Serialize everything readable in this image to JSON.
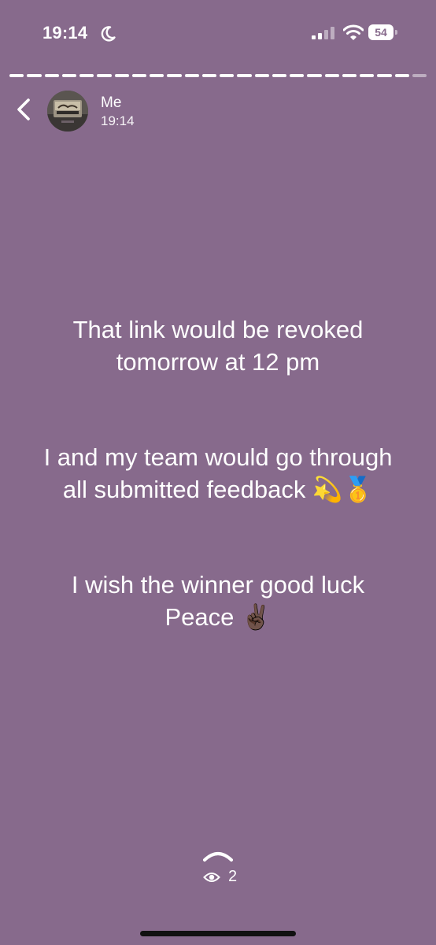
{
  "status_bar": {
    "time": "19:14",
    "battery": "54",
    "icons": [
      "moon-icon",
      "signal-icon",
      "wifi-icon",
      "battery-icon"
    ]
  },
  "story": {
    "progress_total": 24,
    "progress_viewed": 23,
    "author": "Me",
    "posted_time": "19:14",
    "background_color": "#876a8c",
    "paragraphs": [
      "That link would be revoked\ntomorrow at 12 pm",
      "I and my team would go through\nall submitted feedback 💫🥇",
      "I wish the winner good luck\nPeace ✌🏿"
    ]
  },
  "footer": {
    "view_count": "2",
    "icons": [
      "up-chevron-icon",
      "eye-icon"
    ]
  }
}
